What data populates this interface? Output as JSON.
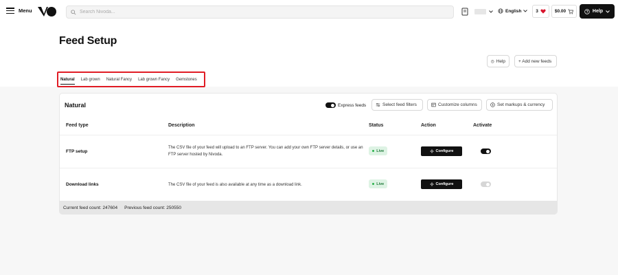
{
  "topbar": {
    "menu_label": "Menu",
    "search_placeholder": "Search Nivoda...",
    "language": "English",
    "wishlist_count": "3",
    "cart_total": "$0.00",
    "help_label": "Help"
  },
  "page": {
    "title": "Feed Setup",
    "help_label": "Help",
    "add_feed_label": "+ Add new feeds"
  },
  "tabs": [
    {
      "label": "Natural",
      "active": true
    },
    {
      "label": "Lab grown",
      "active": false
    },
    {
      "label": "Natural Fancy",
      "active": false
    },
    {
      "label": "Lab grown Fancy",
      "active": false
    },
    {
      "label": "Gemstones",
      "active": false
    }
  ],
  "card": {
    "title": "Natural",
    "express_label": "Express feeds",
    "express_on": true,
    "filters_label": "Select feed filters",
    "columns_label": "Customize columns",
    "markups_label": "Set markups & currency"
  },
  "table": {
    "headers": {
      "type": "Feed type",
      "description": "Description",
      "status": "Status",
      "action": "Action",
      "activate": "Activate"
    },
    "rows": [
      {
        "type": "FTP setup",
        "description": "The CSV file of your feed will upload to an FTP server. You can add your own FTP server details, or use an FTP server hosted by Nivoda.",
        "status": "Live",
        "action": "Configure",
        "active": true
      },
      {
        "type": "Download links",
        "description": "The CSV file of your feed is also available at any time as a download link.",
        "status": "Live",
        "action": "Configure",
        "active": false
      }
    ]
  },
  "footer": {
    "current_label": "Current feed count:",
    "current_value": "247604",
    "previous_label": "Previous feed count:",
    "previous_value": "250550"
  },
  "colors": {
    "accent": "#111111",
    "highlight_frame": "#e01b24",
    "live_bg": "#def3e4",
    "live_text": "#1f7a3a"
  }
}
